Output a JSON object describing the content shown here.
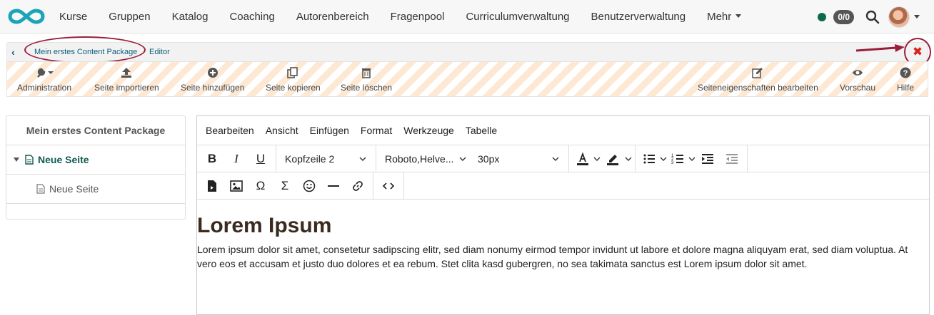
{
  "nav": {
    "items": [
      "Kurse",
      "Gruppen",
      "Katalog",
      "Coaching",
      "Autorenbereich",
      "Fragenpool",
      "Curriculumverwaltung",
      "Benutzerverwaltung",
      "Mehr"
    ],
    "badge": "0/0",
    "accent": "#0a6b4a"
  },
  "breadcrumb": {
    "back": "‹",
    "course": "Mein erstes Content Package",
    "current": "Editor"
  },
  "close_glyph": "✖",
  "toolbar": {
    "administration": "Administration",
    "import": "Seite importieren",
    "add": "Seite hinzufügen",
    "copy": "Seite kopieren",
    "delete": "Seite löschen",
    "properties": "Seiteneigenschaften bearbeiten",
    "preview": "Vorschau",
    "help": "Hilfe"
  },
  "tree": {
    "title": "Mein erstes Content Package",
    "items": [
      {
        "label": "Neue Seite"
      },
      {
        "label": "Neue Seite"
      }
    ]
  },
  "editor": {
    "menu": [
      "Bearbeiten",
      "Ansicht",
      "Einfügen",
      "Format",
      "Werkzeuge",
      "Tabelle"
    ],
    "block_format": "Kopfzeile 2",
    "font_family": "Roboto,Helve...",
    "font_size": "30px",
    "bold": "B",
    "italic": "I",
    "underline": "U",
    "omega": "Ω",
    "sigma": "Σ",
    "heading": "Lorem Ipsum",
    "paragraph": "Lorem ipsum dolor sit amet, consetetur sadipscing elitr, sed diam nonumy eirmod tempor invidunt ut labore et dolore magna aliquyam erat, sed diam voluptua. At vero eos et accusam et justo duo dolores et ea rebum. Stet clita kasd gubergren, no sea takimata sanctus est Lorem ipsum dolor sit amet."
  }
}
